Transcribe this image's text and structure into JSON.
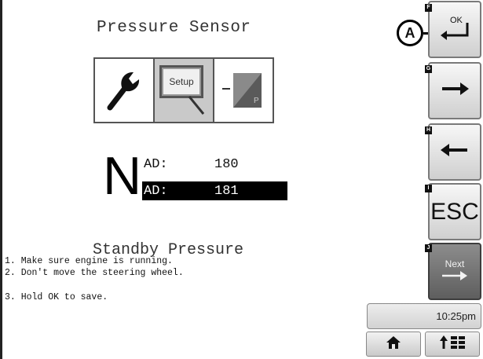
{
  "screen": {
    "title": "Pressure Sensor",
    "section_title": "Standby Pressure",
    "selected_mode": "setup"
  },
  "mode_tabs": [
    {
      "name": "tools",
      "icon": "wrench-icon"
    },
    {
      "name": "setup",
      "icon": "setup-icon",
      "label": "Setup",
      "selected": true
    },
    {
      "name": "pressure",
      "icon": "pressure-graph-icon",
      "label": "P"
    }
  ],
  "gear": {
    "letter": "N"
  },
  "readings": {
    "ad_1": {
      "label": "AD:",
      "value": "180"
    },
    "ad_2": {
      "label": "AD:",
      "value": "181"
    }
  },
  "instructions": [
    "1. Make sure engine is running.",
    "2. Don't move the steering wheel.",
    "3. Hold OK to save."
  ],
  "callout": {
    "label": "A"
  },
  "side_buttons": [
    {
      "key": "F",
      "name": "ok-button",
      "label": "OK",
      "icon": "enter-icon"
    },
    {
      "key": "G",
      "name": "right-arrow-button",
      "icon": "arrow-right-icon"
    },
    {
      "key": "H",
      "name": "left-arrow-button",
      "icon": "arrow-left-icon"
    },
    {
      "key": "I",
      "name": "esc-button",
      "label": "ESC"
    },
    {
      "key": "J",
      "name": "next-button",
      "label": "Next",
      "icon": "arrow-right-icon"
    }
  ],
  "status": {
    "time": "10:25pm"
  },
  "bottom_buttons": [
    {
      "name": "home-button",
      "icon": "home-icon"
    },
    {
      "name": "menu-button",
      "icon": "up-arrow-menu-icon"
    }
  ],
  "colors": {
    "highlight": "#000000",
    "next_button": "#6b6b6b",
    "selected_tab": "#c9c9c9"
  }
}
